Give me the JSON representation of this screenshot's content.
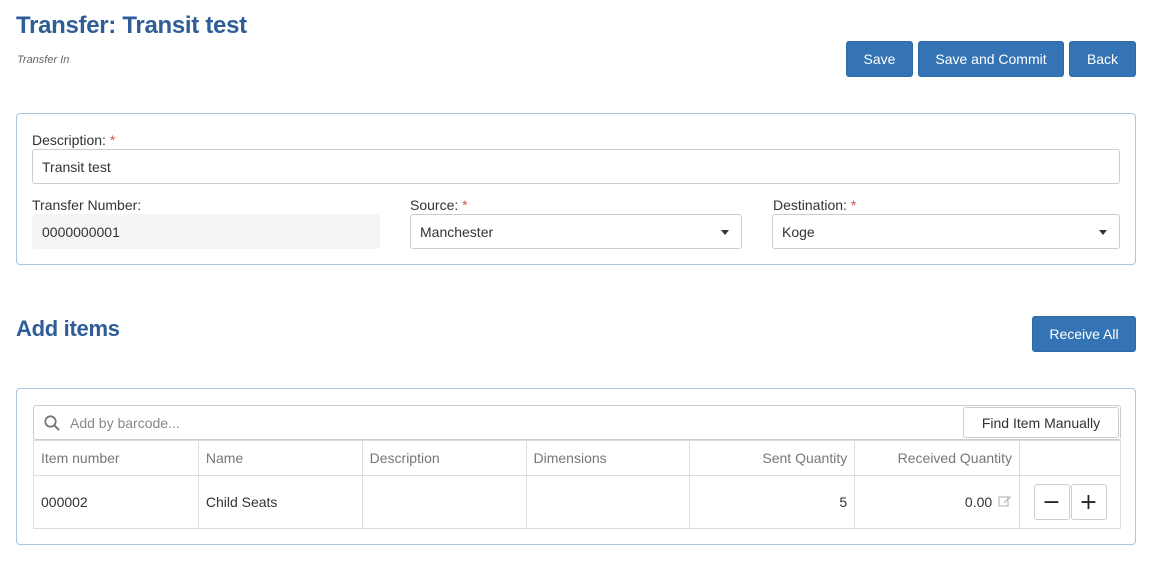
{
  "header": {
    "title": "Transfer: Transit test",
    "subtitle": "Transfer In",
    "save_label": "Save",
    "save_commit_label": "Save and Commit",
    "back_label": "Back"
  },
  "form": {
    "description_label": "Description:",
    "description_value": "Transit test",
    "transfer_number_label": "Transfer Number:",
    "transfer_number_value": "0000000001",
    "source_label": "Source:",
    "source_value": "Manchester",
    "destination_label": "Destination:",
    "destination_value": "Koge",
    "required_mark": "*"
  },
  "items_section": {
    "title": "Add items",
    "receive_all_label": "Receive All",
    "search_placeholder": "Add by barcode...",
    "find_manually_label": "Find Item Manually",
    "columns": [
      "Item number",
      "Name",
      "Description",
      "Dimensions",
      "Sent Quantity",
      "Received Quantity",
      ""
    ],
    "rows": [
      {
        "item_number": "000002",
        "name": "Child Seats",
        "description": "",
        "dimensions": "",
        "sent_quantity": "5",
        "received_quantity": "0.00",
        "minus": "−",
        "plus": "+"
      }
    ]
  },
  "colors": {
    "accent": "#3474b5",
    "title": "#2e5d97",
    "panel_border": "#a9c5e0",
    "required": "#d9534f"
  },
  "icons": {
    "search": "search-icon",
    "dropdown": "chevron-down-icon",
    "edit": "edit-icon"
  }
}
